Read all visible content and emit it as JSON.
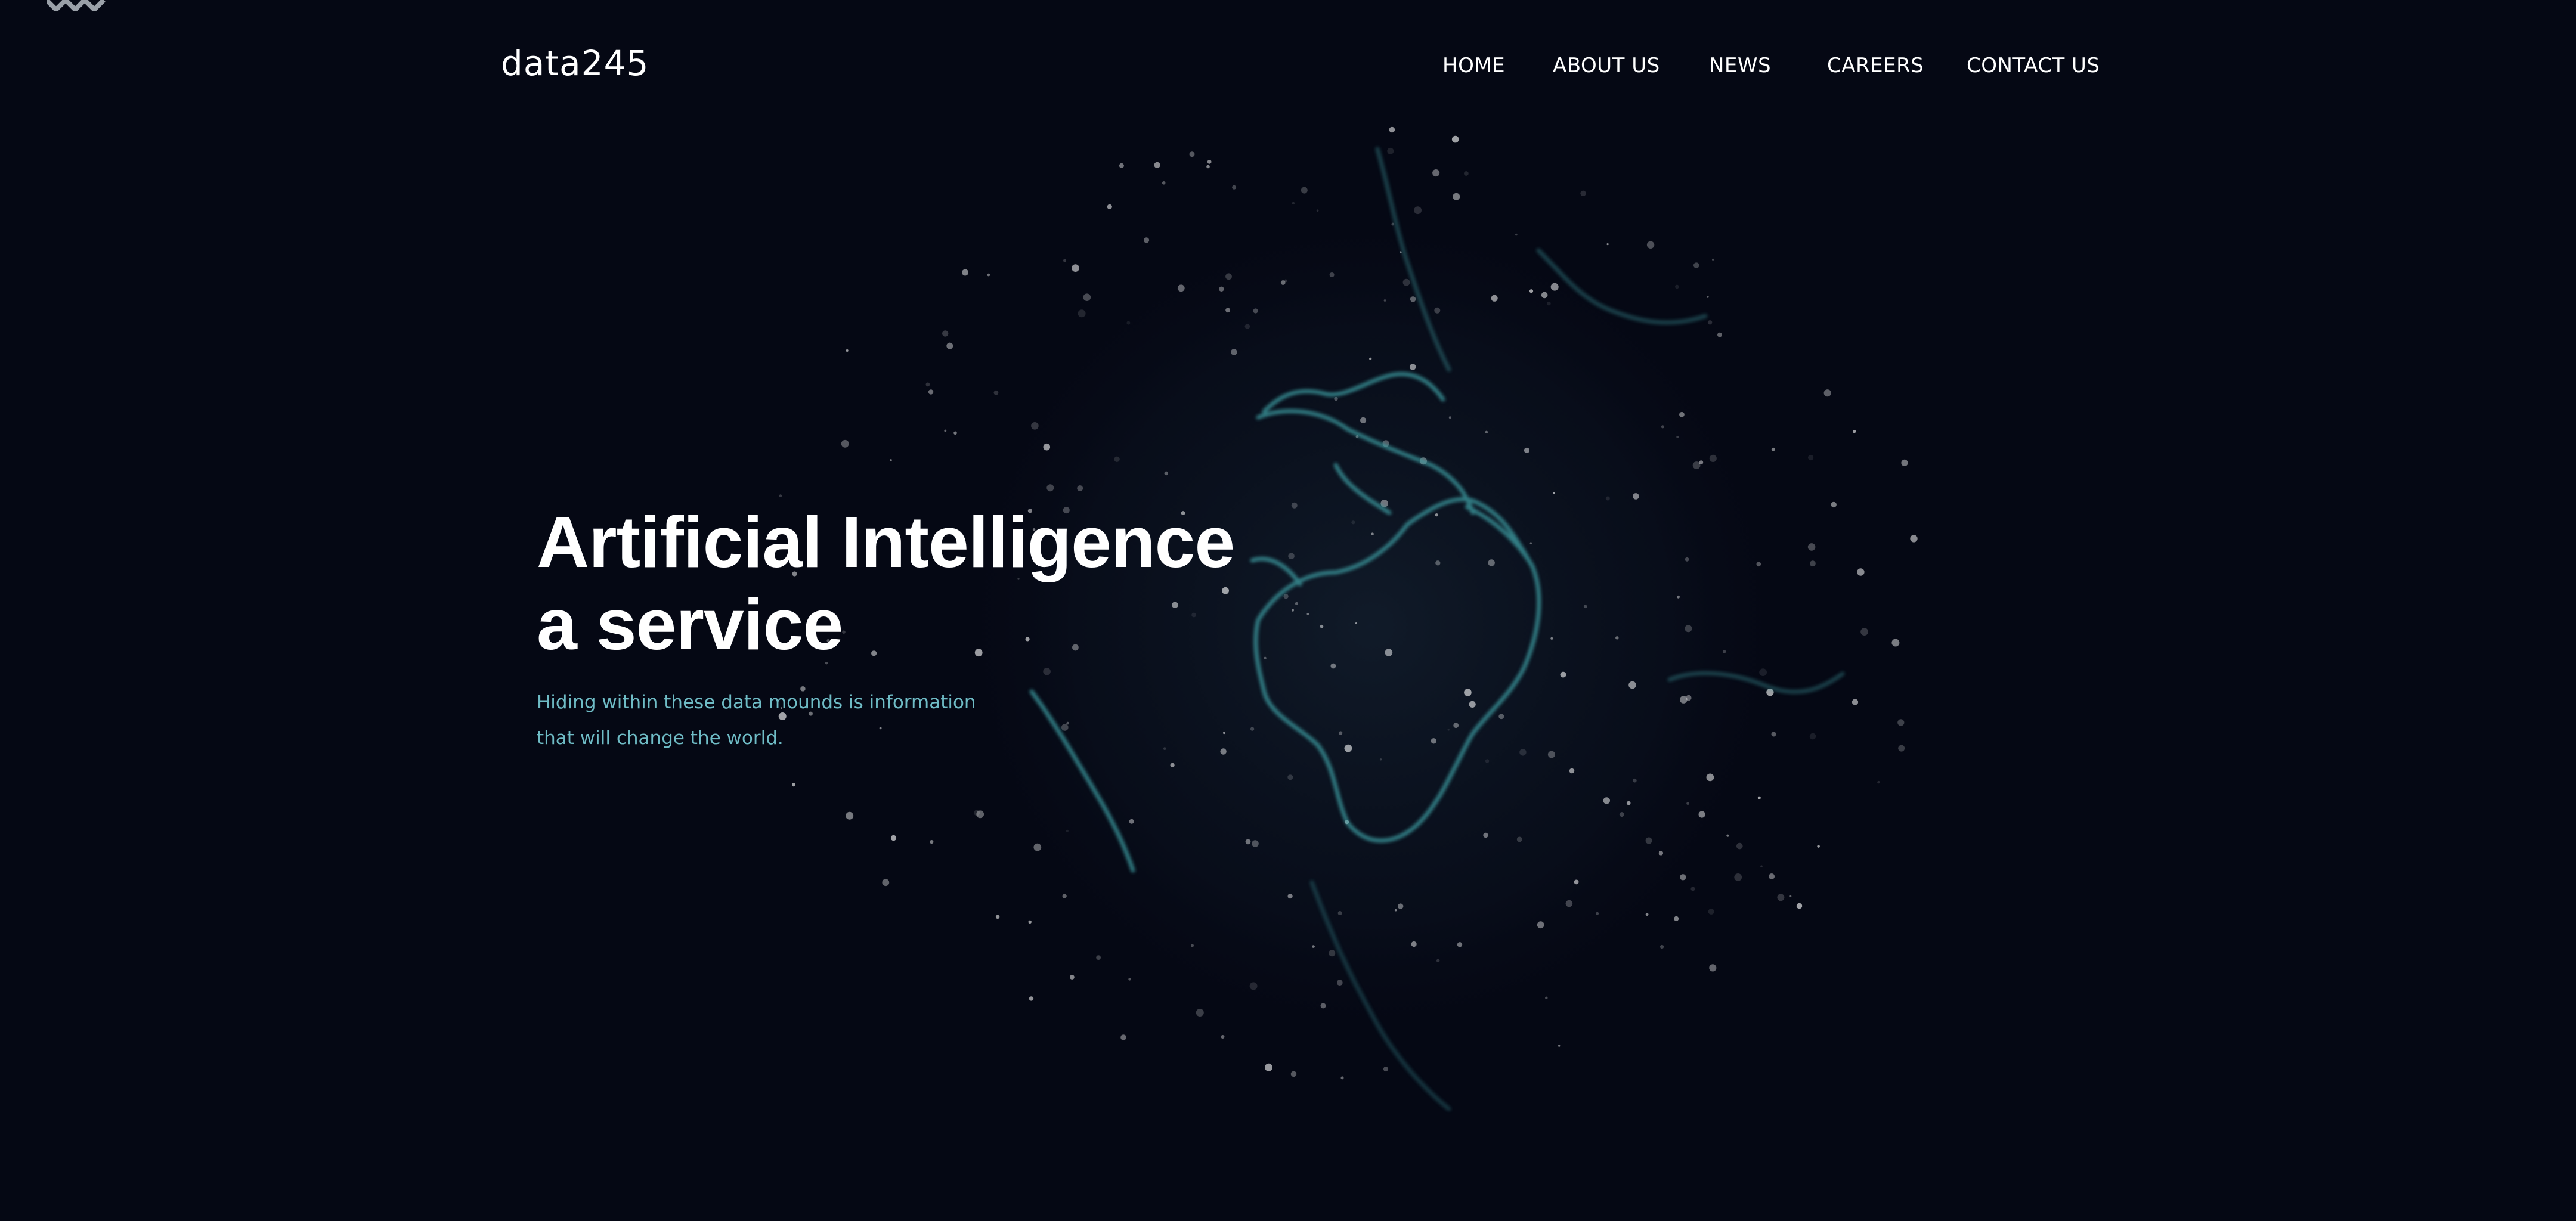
{
  "brand": {
    "name": "data245",
    "corner_logo_icon": "chevron-pattern-logo"
  },
  "nav": {
    "items": [
      {
        "label": "HOME"
      },
      {
        "label": "ABOUT US"
      },
      {
        "label": "NEWS"
      },
      {
        "label": "CAREERS"
      },
      {
        "label": "CONTACT US"
      }
    ]
  },
  "hero": {
    "title_line1": "Artificial Intelligence",
    "title_line2": "a service",
    "subtitle_line1": "Hiding within these data mounds is information",
    "subtitle_line2": "that will change the world.",
    "background_icon": "earth-globe-network-graphic"
  },
  "colors": {
    "background": "#050814",
    "text": "#ffffff",
    "accent": "#6fbcc6",
    "globe_lines": "#3fa3a7"
  }
}
